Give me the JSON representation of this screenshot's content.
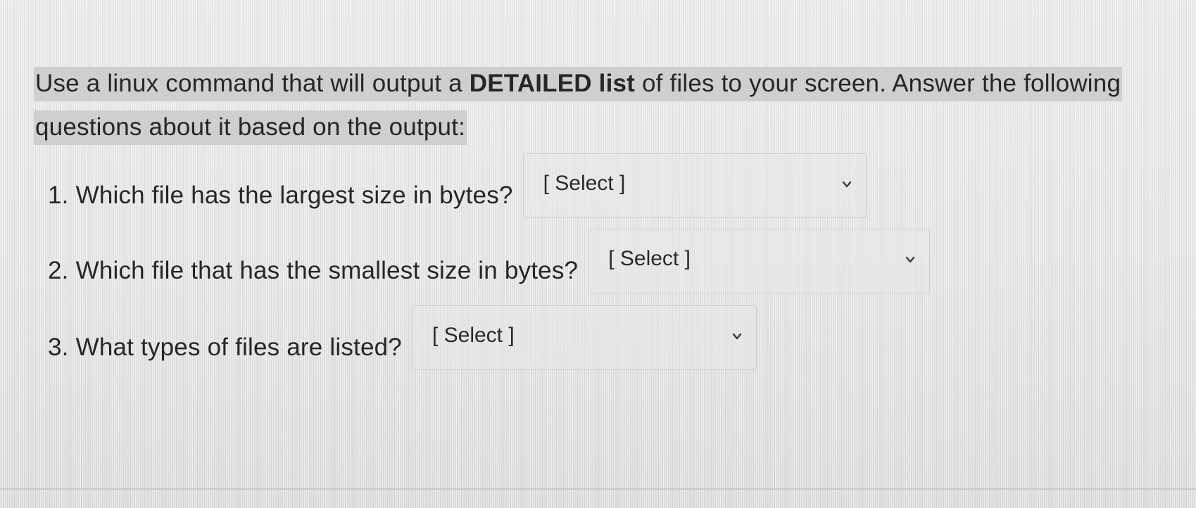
{
  "intro": {
    "part1": "Use a linux command that will output a ",
    "bold": "DETAILED list",
    "part2": " of files to your screen. Answer the following questions about it based on the output:"
  },
  "questions": [
    {
      "number": "1.",
      "text": "Which file has the largest size in bytes?",
      "select_value": "[ Select ]",
      "icon": "chevron-down-icon"
    },
    {
      "number": "2.",
      "text": "Which file that has the smallest size in bytes?",
      "select_value": "[ Select ]",
      "icon": "chevron-down-icon"
    },
    {
      "number": "3.",
      "text": "What types of files are listed?",
      "select_value": "[ Select ]",
      "icon": "chevron-down-icon"
    }
  ],
  "colors": {
    "text": "#262626",
    "highlight": "#cfcfcf",
    "select_border": "#cfcfcf"
  }
}
